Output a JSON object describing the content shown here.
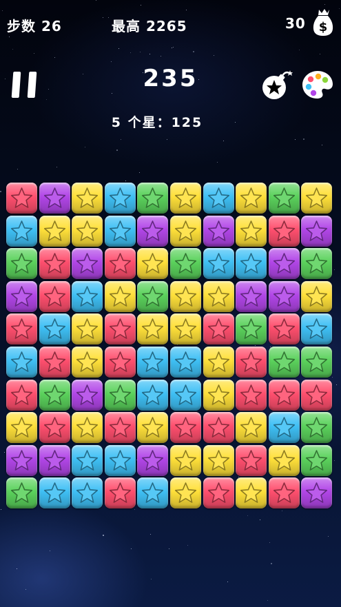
{
  "hud": {
    "steps_text": "步数 26",
    "best_text": "最高 2265",
    "coins_text": "30",
    "score": "235",
    "combo_text": "5 个星：125"
  },
  "icons": {
    "pause": "pause-icon",
    "money": "money-bag-icon",
    "bomb": "bomb-icon",
    "palette": "palette-icon"
  },
  "colors": {
    "R": "#ff4f6e",
    "P": "#b246e8",
    "Y": "#ffe03a",
    "B": "#3fc0f5",
    "G": "#5bd25c"
  },
  "board": [
    [
      "R",
      "P",
      "Y",
      "B",
      "G",
      "Y",
      "B",
      "Y",
      "G",
      "Y"
    ],
    [
      "B",
      "Y",
      "Y",
      "B",
      "P",
      "Y",
      "P",
      "Y",
      "R",
      "P"
    ],
    [
      "G",
      "R",
      "P",
      "R",
      "Y",
      "G",
      "B",
      "B",
      "P",
      "G"
    ],
    [
      "P",
      "R",
      "B",
      "Y",
      "G",
      "Y",
      "Y",
      "P",
      "P",
      "Y"
    ],
    [
      "R",
      "B",
      "Y",
      "R",
      "Y",
      "Y",
      "R",
      "G",
      "R",
      "B"
    ],
    [
      "B",
      "R",
      "Y",
      "R",
      "B",
      "B",
      "Y",
      "R",
      "G",
      "G"
    ],
    [
      "R",
      "G",
      "P",
      "G",
      "B",
      "B",
      "Y",
      "R",
      "R",
      "R"
    ],
    [
      "Y",
      "R",
      "Y",
      "R",
      "Y",
      "R",
      "R",
      "Y",
      "B",
      "G"
    ],
    [
      "P",
      "P",
      "B",
      "B",
      "P",
      "Y",
      "Y",
      "R",
      "Y",
      "G"
    ],
    [
      "G",
      "B",
      "B",
      "R",
      "B",
      "Y",
      "R",
      "Y",
      "R",
      "P"
    ]
  ]
}
